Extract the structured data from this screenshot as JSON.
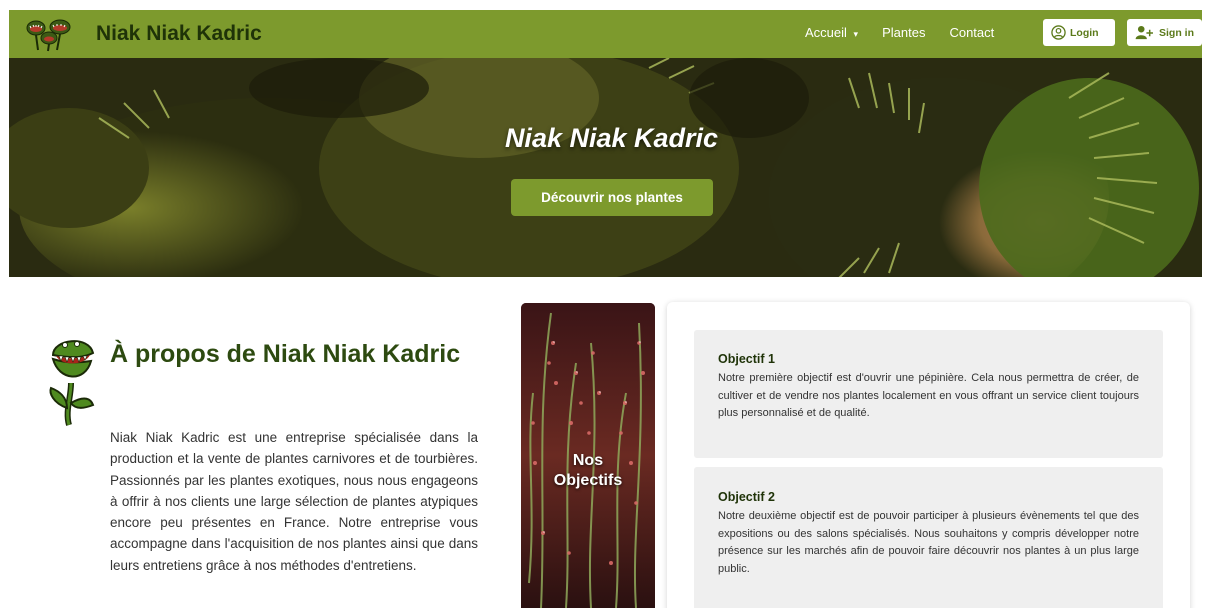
{
  "navbar": {
    "brand": "Niak Niak Kadric",
    "links": [
      {
        "label": "Accueil",
        "caret": "▾"
      },
      {
        "label": "Plantes"
      },
      {
        "label": "Contact"
      }
    ],
    "login_label": "Login",
    "signin_label": "Sign in",
    "background": "#7d9a2d"
  },
  "hero": {
    "title": "Niak Niak Kadric",
    "cta_label": "Découvrir nos plantes"
  },
  "about": {
    "title": "À propos de Niak Niak Kadric",
    "text": "Niak Niak Kadric est une entreprise spécialisée dans la production et la vente de plantes carnivores et de tourbières. Passionnés par les plantes exotiques, nous nous engageons à offrir à nos clients une large sélection de plantes atypiques encore peu présentes en France. Notre entreprise vous accompagne dans l'acquisition de nos plantes ainsi que dans leurs entretiens grâce à nos méthodes d'entretiens."
  },
  "objectives": {
    "image_label_line1": "Nos",
    "image_label_line2": "Objectifs",
    "items": [
      {
        "title": "Objectif 1",
        "text": "Notre première objectif est d'ouvrir une pépinière. Cela nous permettra de créer, de cultiver et de vendre nos plantes localement en vous offrant un service client toujours plus personnalisé et de qualité."
      },
      {
        "title": "Objectif 2",
        "text": "Notre deuxième objectif est de pouvoir participer à plusieurs évènements tel que des expositions ou des salons spécialisés. Nous souhaitons y compris développer notre présence sur les marchés afin de pouvoir faire découvrir nos plantes à un plus large public."
      }
    ]
  },
  "icons": {
    "logo": "venus-flytrap-logo-icon",
    "login": "user-circle-icon",
    "signin": "user-plus-icon",
    "about": "carnivorous-plant-icon"
  }
}
